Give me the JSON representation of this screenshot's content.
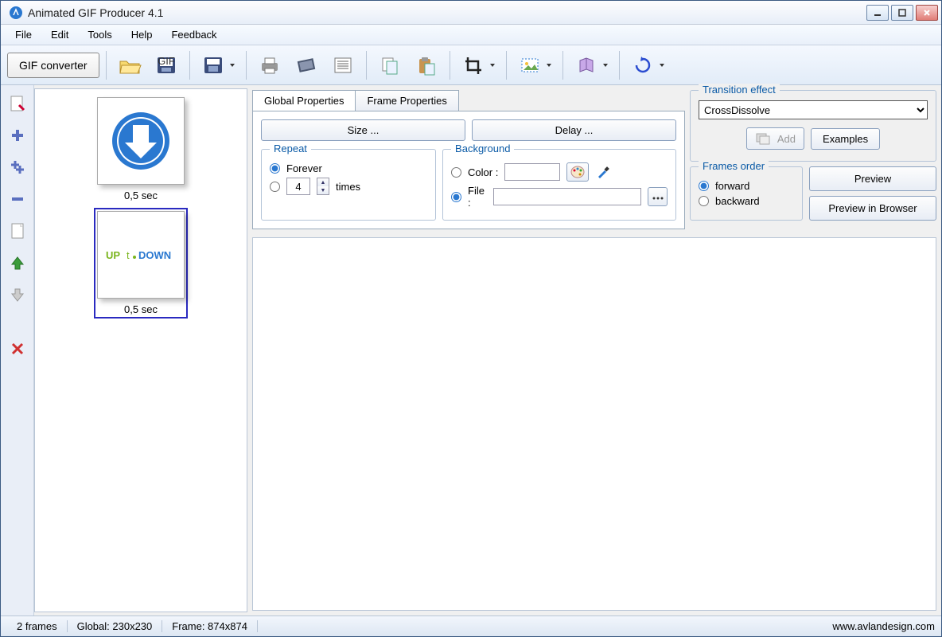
{
  "title": "Animated GIF Producer 4.1",
  "menu": [
    "File",
    "Edit",
    "Tools",
    "Help",
    "Feedback"
  ],
  "toolbar": {
    "gif_converter": "GIF converter"
  },
  "frames": [
    {
      "caption": "0,5 sec",
      "selected": false
    },
    {
      "caption": "0,5 sec",
      "selected": true
    }
  ],
  "tabs": {
    "global": "Global Properties",
    "frame": "Frame Properties"
  },
  "buttons": {
    "size": "Size ...",
    "delay": "Delay ...",
    "add": "Add",
    "examples": "Examples",
    "preview": "Preview",
    "preview_browser": "Preview in Browser"
  },
  "repeat": {
    "legend": "Repeat",
    "forever": "Forever",
    "times_value": "4",
    "times_label": "times"
  },
  "background": {
    "legend": "Background",
    "color_label": "Color :",
    "file_label": "File :"
  },
  "transition": {
    "legend": "Transition effect",
    "value": "CrossDissolve"
  },
  "frames_order": {
    "legend": "Frames order",
    "forward": "forward",
    "backward": "backward"
  },
  "status": {
    "frames": "2 frames",
    "global": "Global: 230x230",
    "frame": "Frame: 874x874",
    "url": "www.avlandesign.com"
  }
}
